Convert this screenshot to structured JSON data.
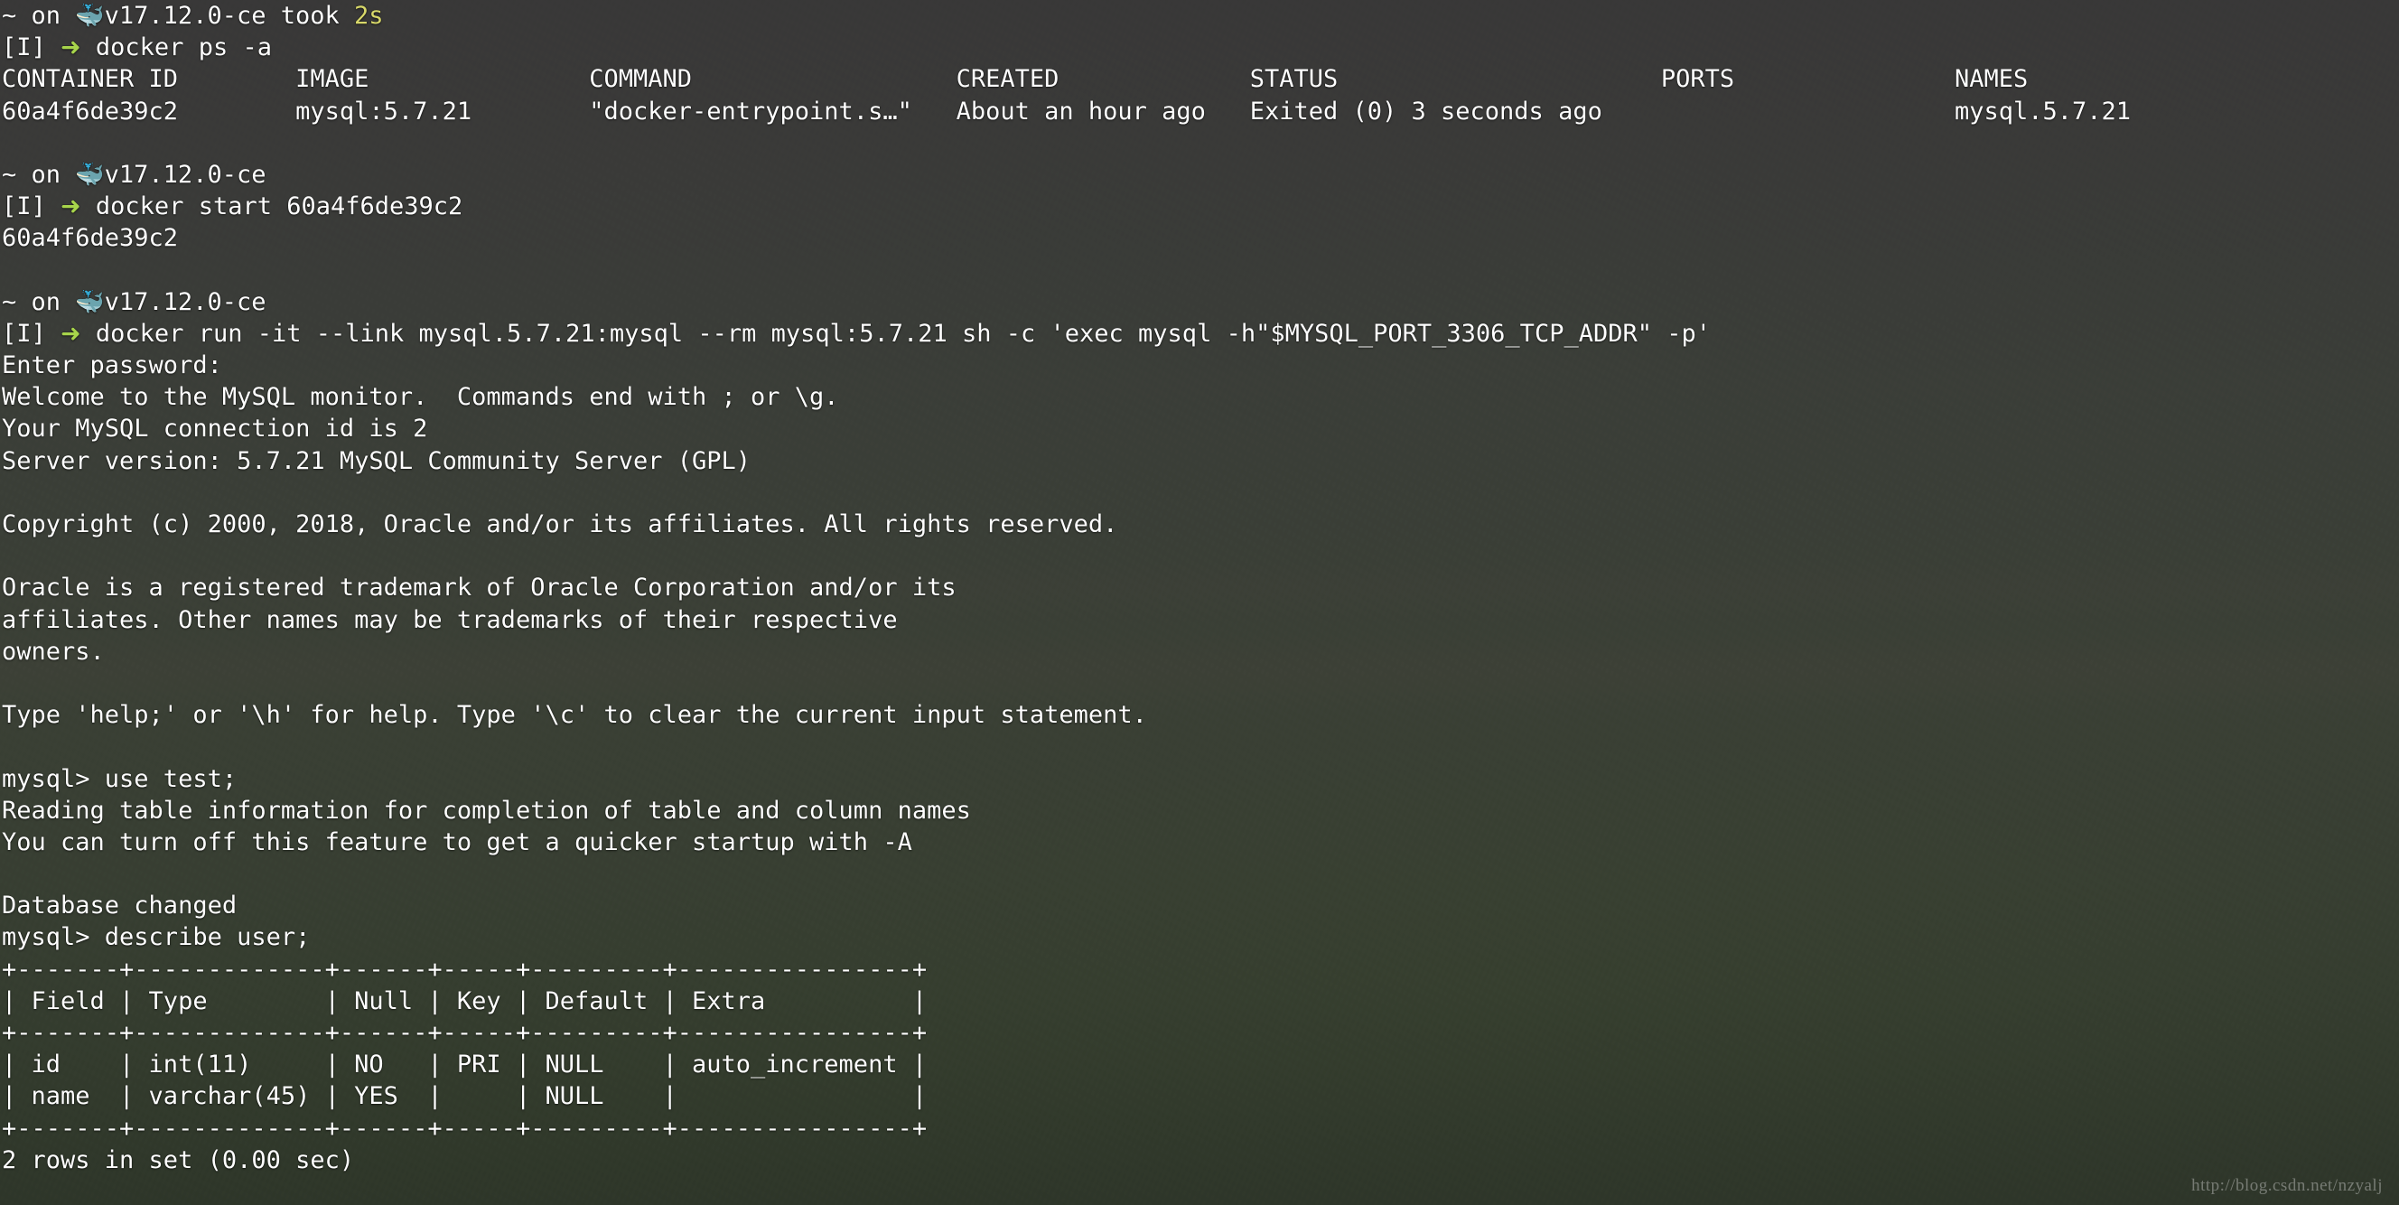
{
  "terminal": {
    "title": "zsh terminal - docker / mysql session",
    "colors": {
      "foreground": "#ffffff",
      "background": "#3a3b3d",
      "yellow": "#d8d86a",
      "green": "#a7d44b",
      "cyan": "#6fd0d8"
    },
    "watermark": "http://blog.csdn.net/nzyalj"
  },
  "prompt": {
    "host_prefix": "~ on ",
    "whale_icon": "🐳",
    "docker_version": "v17.12.0-ce",
    "took_label": " took ",
    "took_value": "2s",
    "vi_mode": "[I] ",
    "arrow": "➜",
    "space": " "
  },
  "lines": [
    {
      "type": "prompt1",
      "prefix": "~ on ",
      "icon": "🐳",
      "version": "v17.12.0-ce",
      "took_label": " took ",
      "took": "2s"
    },
    {
      "type": "prompt2",
      "mode": "[I] ",
      "arrow": "➜",
      "command": " docker ps -a"
    },
    {
      "type": "out",
      "text": "CONTAINER ID        IMAGE               COMMAND                  CREATED             STATUS                      PORTS               NAMES"
    },
    {
      "type": "out",
      "text": "60a4f6de39c2        mysql:5.7.21        \"docker-entrypoint.s…\"   About an hour ago   Exited (0) 3 seconds ago                        mysql.5.7.21"
    },
    {
      "type": "blank"
    },
    {
      "type": "prompt1",
      "prefix": "~ on ",
      "icon": "🐳",
      "version": "v17.12.0-ce",
      "took_label": "",
      "took": ""
    },
    {
      "type": "prompt2",
      "mode": "[I] ",
      "arrow": "➜",
      "command": " docker start 60a4f6de39c2"
    },
    {
      "type": "out",
      "text": "60a4f6de39c2"
    },
    {
      "type": "blank"
    },
    {
      "type": "prompt1",
      "prefix": "~ on ",
      "icon": "🐳",
      "version": "v17.12.0-ce",
      "took_label": "",
      "took": ""
    },
    {
      "type": "prompt2",
      "mode": "[I] ",
      "arrow": "➜",
      "command": " docker run -it --link mysql.5.7.21:mysql --rm mysql:5.7.21 sh -c 'exec mysql -h\"$MYSQL_PORT_3306_TCP_ADDR\" -p'"
    },
    {
      "type": "out",
      "text": "Enter password:"
    },
    {
      "type": "out",
      "text": "Welcome to the MySQL monitor.  Commands end with ; or \\g."
    },
    {
      "type": "out",
      "text": "Your MySQL connection id is 2"
    },
    {
      "type": "out",
      "text": "Server version: 5.7.21 MySQL Community Server (GPL)"
    },
    {
      "type": "blank"
    },
    {
      "type": "out",
      "text": "Copyright (c) 2000, 2018, Oracle and/or its affiliates. All rights reserved."
    },
    {
      "type": "blank"
    },
    {
      "type": "out",
      "text": "Oracle is a registered trademark of Oracle Corporation and/or its"
    },
    {
      "type": "out",
      "text": "affiliates. Other names may be trademarks of their respective"
    },
    {
      "type": "out",
      "text": "owners."
    },
    {
      "type": "blank"
    },
    {
      "type": "out",
      "text": "Type 'help;' or '\\h' for help. Type '\\c' to clear the current input statement."
    },
    {
      "type": "blank"
    },
    {
      "type": "out",
      "text": "mysql> use test;"
    },
    {
      "type": "out",
      "text": "Reading table information for completion of table and column names"
    },
    {
      "type": "out",
      "text": "You can turn off this feature to get a quicker startup with -A"
    },
    {
      "type": "blank"
    },
    {
      "type": "out",
      "text": "Database changed"
    },
    {
      "type": "out",
      "text": "mysql> describe user;"
    },
    {
      "type": "out",
      "text": "+-------+-------------+------+-----+---------+----------------+"
    },
    {
      "type": "out",
      "text": "| Field | Type        | Null | Key | Default | Extra          |"
    },
    {
      "type": "out",
      "text": "+-------+-------------+------+-----+---------+----------------+"
    },
    {
      "type": "out",
      "text": "| id    | int(11)     | NO   | PRI | NULL    | auto_increment |"
    },
    {
      "type": "out",
      "text": "| name  | varchar(45) | YES  |     | NULL    |                |"
    },
    {
      "type": "out",
      "text": "+-------+-------------+------+-----+---------+----------------+"
    },
    {
      "type": "out",
      "text": "2 rows in set (0.00 sec)"
    }
  ],
  "docker_ps": {
    "headers": [
      "CONTAINER ID",
      "IMAGE",
      "COMMAND",
      "CREATED",
      "STATUS",
      "PORTS",
      "NAMES"
    ],
    "rows": [
      {
        "container_id": "60a4f6de39c2",
        "image": "mysql:5.7.21",
        "command": "\"docker-entrypoint.s…\"",
        "created": "About an hour ago",
        "status": "Exited (0) 3 seconds ago",
        "ports": "",
        "names": "mysql.5.7.21"
      }
    ]
  },
  "mysql_describe": {
    "table": "user",
    "headers": [
      "Field",
      "Type",
      "Null",
      "Key",
      "Default",
      "Extra"
    ],
    "rows": [
      [
        "id",
        "int(11)",
        "NO",
        "PRI",
        "NULL",
        "auto_increment"
      ],
      [
        "name",
        "varchar(45)",
        "YES",
        "",
        "NULL",
        ""
      ]
    ],
    "footer": "2 rows in set (0.00 sec)"
  }
}
